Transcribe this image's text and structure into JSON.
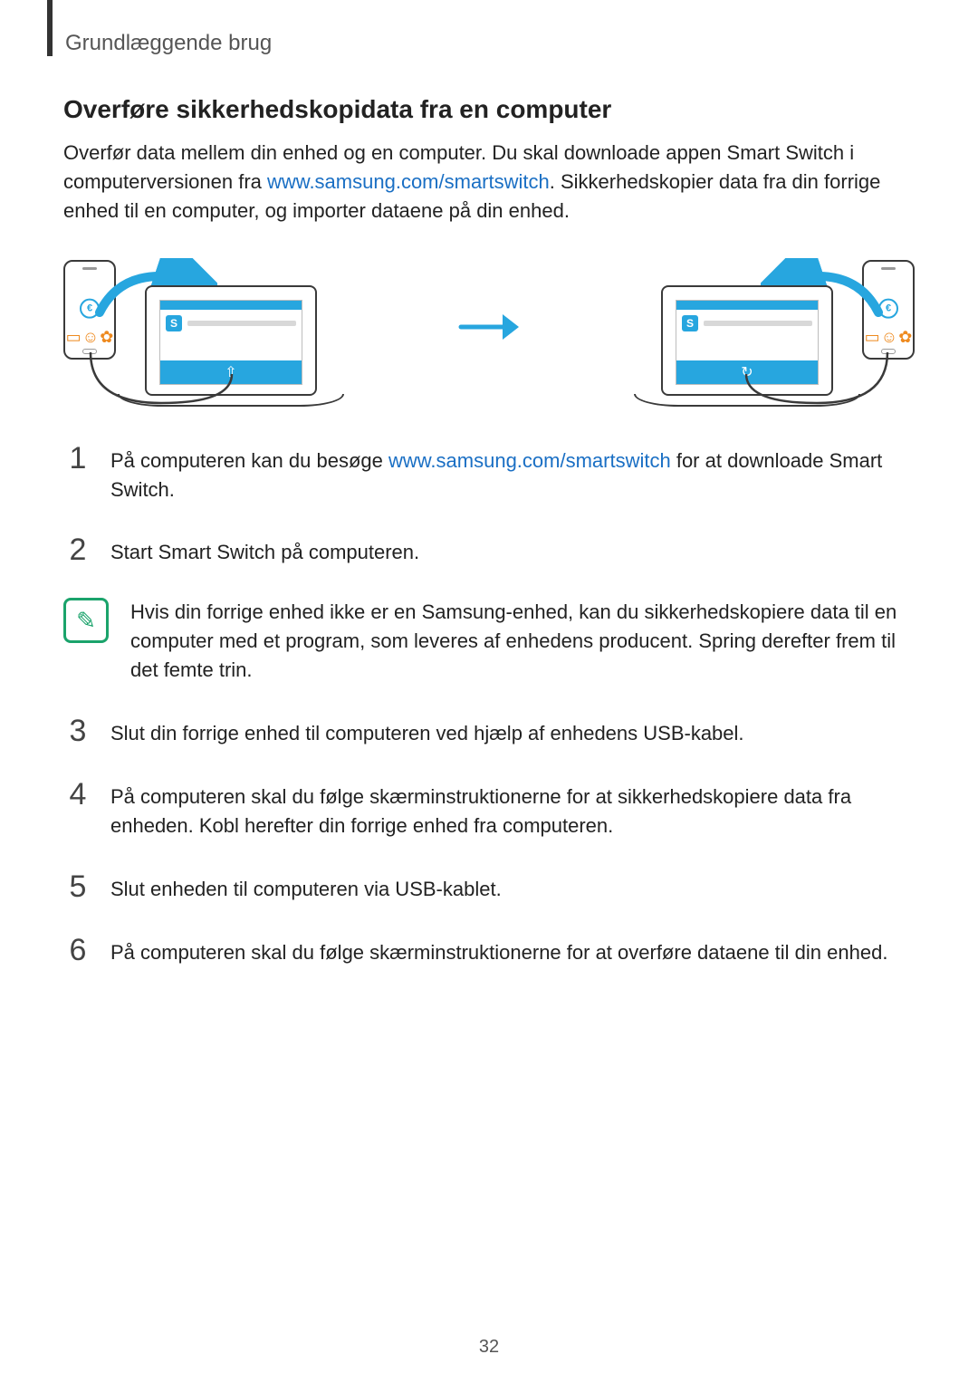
{
  "header": {
    "label": "Grundlæggende brug"
  },
  "section": {
    "title": "Overføre sikkerhedskopidata fra en computer",
    "intro_pre": "Overfør data mellem din enhed og en computer. Du skal downloade appen Smart Switch i computerversionen fra ",
    "intro_link": "www.samsung.com/smartswitch",
    "intro_post": ". Sikkerhedskopier data fra din forrige enhed til en computer, og importer dataene på din enhed."
  },
  "steps": [
    {
      "num": "1",
      "pre": "På computeren kan du besøge ",
      "link": "www.samsung.com/smartswitch",
      "post": " for at downloade Smart Switch."
    },
    {
      "num": "2",
      "text": "Start Smart Switch på computeren."
    },
    {
      "num": "3",
      "text": "Slut din forrige enhed til computeren ved hjælp af enhedens USB-kabel."
    },
    {
      "num": "4",
      "text": "På computeren skal du følge skærminstruktionerne for at sikkerhedskopiere data fra enheden. Kobl herefter din forrige enhed fra computeren."
    },
    {
      "num": "5",
      "text": "Slut enheden til computeren via USB-kablet."
    },
    {
      "num": "6",
      "text": "På computeren skal du følge skærminstruktionerne for at overføre dataene til din enhed."
    }
  ],
  "note": {
    "text": "Hvis din forrige enhed ikke er en Samsung-enhed, kan du sikkerhedskopiere data til en computer med et program, som leveres af enhedens producent. Spring derefter frem til det femte trin."
  },
  "icons": {
    "pencil": "✎",
    "smartswitch": "S",
    "upload": "⇧",
    "restore": "↻",
    "contact": "☺",
    "gear": "✿",
    "msg": "▭",
    "euro": "€"
  },
  "page_number": "32"
}
